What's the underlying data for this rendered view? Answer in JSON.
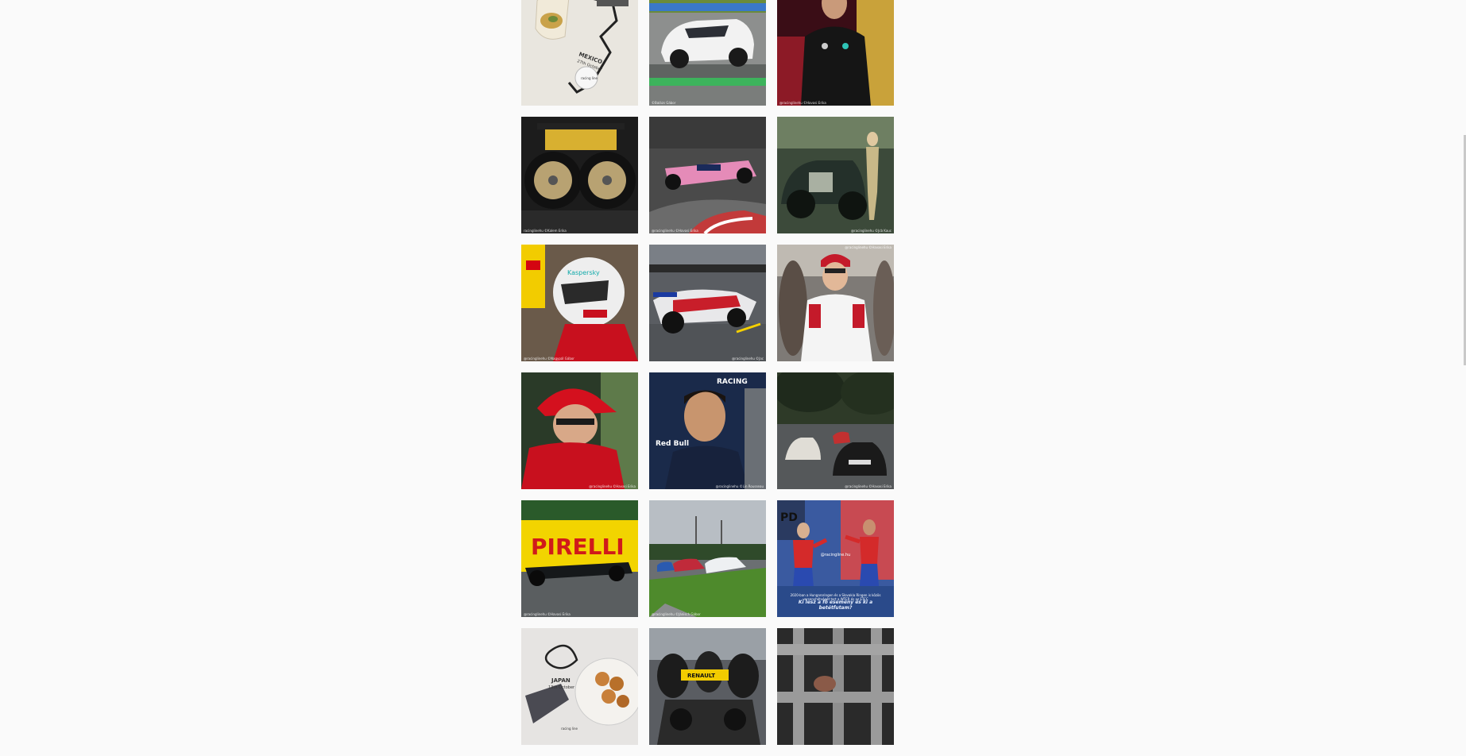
{
  "feed": {
    "rows": [
      [
        {
          "name": "post-mexico-food",
          "credit": ""
        },
        {
          "name": "post-white-race-car",
          "credit": "©Balázs Gábor"
        },
        {
          "name": "post-mercedes-driver",
          "credit": "@racinglinehu ©Havasi Erika"
        }
      ],
      [
        {
          "name": "post-gold-wheels",
          "credit": "racinglinehu ©Kalem Erika"
        },
        {
          "name": "post-pink-f1-car",
          "credit": "@racinglinehu ©Havasi Erika"
        },
        {
          "name": "post-vintage-car-woman",
          "credit": "@racinglinehu ©Jcb Kauc"
        }
      ],
      [
        {
          "name": "post-ferrari-helmet",
          "credit": "@racinglinehu ©Nagypál Gábor"
        },
        {
          "name": "post-formula-e-car",
          "credit": "@racinglinehu ©Jac"
        },
        {
          "name": "post-alfa-driver",
          "credit": "@racinglinehu ©Havasi Erika"
        }
      ],
      [
        {
          "name": "post-leclerc",
          "credit": "@racinglinehu ©Havasi Erika"
        },
        {
          "name": "post-albon",
          "credit": "@racinglinehu ©Lin Rousseau"
        },
        {
          "name": "post-classic-porsche",
          "credit": "@racinglinehu ©Havasi Erika"
        }
      ],
      [
        {
          "name": "post-pirelli-mercedes",
          "credit": "@racinglinehu ©Havasi Erika"
        },
        {
          "name": "post-touring-cars",
          "credit": "@racinglinehu ©Jánisch Gábor"
        },
        {
          "name": "post-spiderman-meme",
          "credit": ""
        }
      ],
      [
        {
          "name": "post-japan-food",
          "credit": ""
        },
        {
          "name": "post-renault-pitstop",
          "credit": ""
        },
        {
          "name": "post-fence-closeup",
          "credit": ""
        }
      ]
    ],
    "mexico": {
      "title": "MEXICO",
      "date": "27th October",
      "badge": "racing line"
    },
    "japan": {
      "title": "JAPAN",
      "date": "13th October",
      "badge": "racing line"
    },
    "meme": {
      "handle": "@racingline.hu",
      "caption_small": "2020-ban a Hungaroringen és a Slovakia Ringen is közös versenyhétvégét tart a WTCR és az ETCC",
      "caption_big": "Ki lesz a fő esemény és ki a betétfutam?"
    },
    "signage": {
      "pirelli": "PIRELLI",
      "redbull_racing": "RACING",
      "redbull": "Red Bull",
      "kaspersky": "Kaspersky",
      "renault": "RENAULT"
    }
  },
  "colors": {
    "background": "#fafafa",
    "scrollbar_thumb": "#c9c9c9"
  }
}
